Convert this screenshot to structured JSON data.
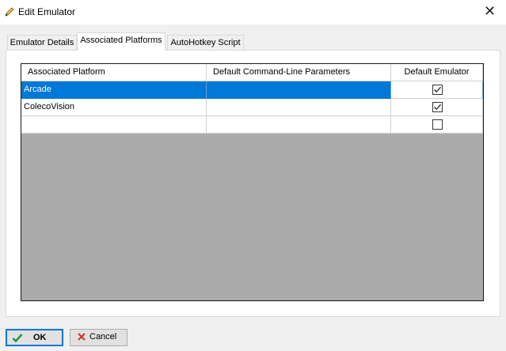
{
  "window": {
    "title": "Edit Emulator"
  },
  "tabs": [
    {
      "label": "Emulator Details"
    },
    {
      "label": "Associated Platforms"
    },
    {
      "label": "AutoHotkey Script"
    }
  ],
  "grid": {
    "headers": [
      "Associated Platform",
      "Default Command-Line Parameters",
      "Default Emulator"
    ],
    "rows": [
      {
        "platform": "Arcade",
        "params": "",
        "default": true,
        "selected": true
      },
      {
        "platform": "ColecoVision",
        "params": "",
        "default": true,
        "selected": false
      },
      {
        "platform": "",
        "params": "",
        "default": false,
        "selected": false
      }
    ]
  },
  "buttons": {
    "ok": "OK",
    "cancel": "Cancel"
  },
  "colors": {
    "selection": "#0078d7",
    "ok_check": "#1e9a3c",
    "cancel_x": "#d32f2f"
  }
}
